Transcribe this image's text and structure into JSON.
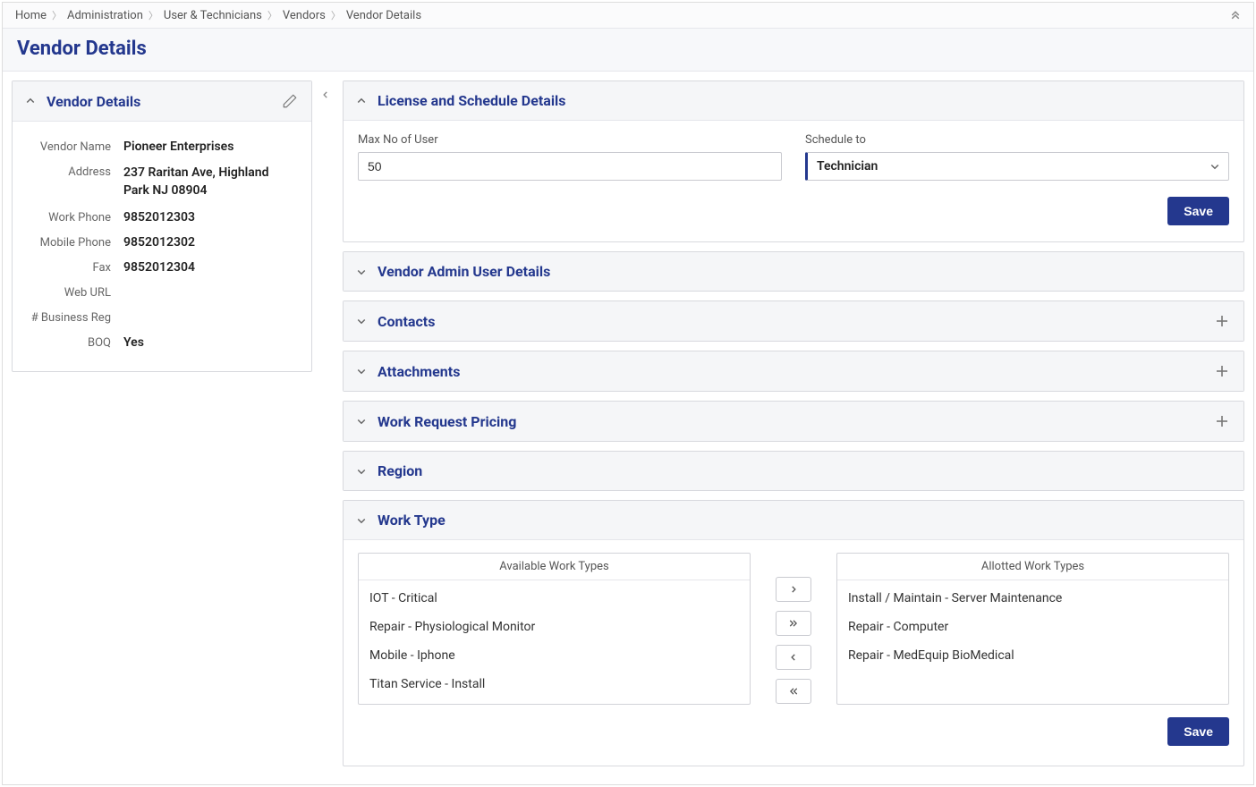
{
  "breadcrumb": {
    "home": "Home",
    "administration": "Administration",
    "users_technicians": "User & Technicians",
    "vendors": "Vendors",
    "current": "Vendor Details"
  },
  "page_title": "Vendor Details",
  "vendor_details": {
    "panel_title": "Vendor Details",
    "vendor_name_label": "Vendor Name",
    "vendor_name": "Pioneer Enterprises",
    "address_label": "Address",
    "address": "237 Raritan Ave, Highland Park NJ 08904",
    "work_phone_label": "Work Phone",
    "work_phone": "9852012303",
    "mobile_phone_label": "Mobile Phone",
    "mobile_phone": "9852012302",
    "fax_label": "Fax",
    "fax": "9852012304",
    "web_url_label": "Web URL",
    "web_url": "",
    "business_reg_label": "# Business Reg",
    "business_reg": "",
    "boq_label": "BOQ",
    "boq": "Yes"
  },
  "license_schedule": {
    "panel_title": "License and Schedule Details",
    "max_users_label": "Max No of User",
    "max_users_value": "50",
    "schedule_to_label": "Schedule to",
    "schedule_to_value": "Technician",
    "save_label": "Save"
  },
  "sections": {
    "vendor_admin": "Vendor Admin User Details",
    "contacts": "Contacts",
    "attachments": "Attachments",
    "work_request_pricing": "Work Request Pricing",
    "region": "Region",
    "work_type": "Work Type"
  },
  "work_type": {
    "available_header": "Available Work Types",
    "allotted_header": "Allotted Work Types",
    "available": [
      "IOT - Critical",
      "Repair - Physiological Monitor",
      "Mobile - Iphone",
      "Titan Service - Install"
    ],
    "allotted": [
      "Install / Maintain - Server Maintenance",
      "Repair - Computer",
      "Repair - MedEquip BioMedical"
    ],
    "save_label": "Save"
  }
}
